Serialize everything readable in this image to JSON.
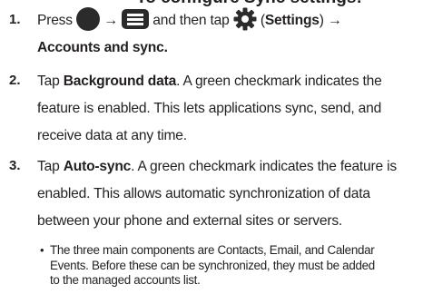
{
  "heading_clip": "To configure Sync settings:",
  "steps": [
    {
      "number": "1.",
      "line1": {
        "t1": "Press",
        "t2": "and then tap",
        "t3": "(",
        "settings": "Settings",
        "t4": ")",
        "arrow": "→"
      },
      "line2": {
        "bold": "Accounts and sync",
        "period": "."
      }
    },
    {
      "number": "2.",
      "lead": "Tap ",
      "bold": "Background data",
      "line1_rest": ". A green checkmark indicates the",
      "line2": "feature is enabled. This lets applications sync, send, and",
      "line3": "receive data at any time."
    },
    {
      "number": "3.",
      "lead": "Tap ",
      "bold": "Auto-sync",
      "line1_rest": ". A green checkmark indicates the feature is",
      "line2": "enabled. This allows automatic synchronization of data",
      "line3": "between your phone and external sites or servers."
    }
  ],
  "bullet": {
    "dot": "•",
    "line1": "The three main components are Contacts, Email, and Calendar",
    "line2": "Events. Before these can be synchronized, they must be added",
    "line3": "to the managed accounts list."
  },
  "icons": [
    "home-key-icon",
    "menu-key-icon",
    "settings-gear-icon"
  ],
  "colors": {
    "text": "#231f20",
    "icon": "#2b2b2b"
  }
}
